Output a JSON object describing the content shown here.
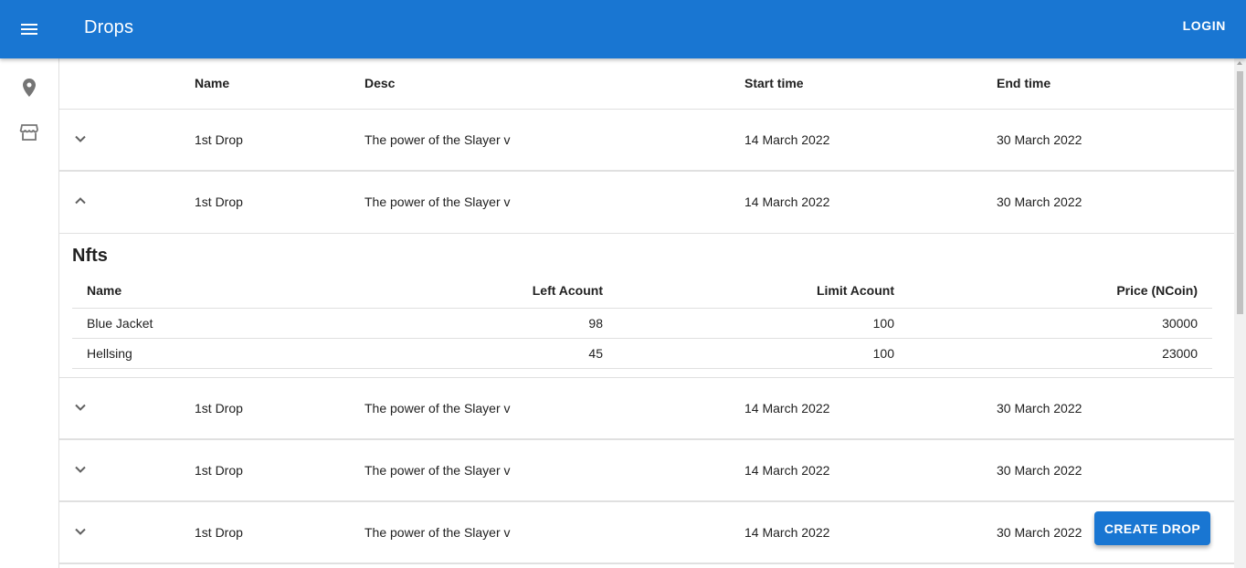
{
  "appbar": {
    "title": "Drops",
    "login_label": "LOGIN"
  },
  "sidebar": {
    "icons": [
      "location-pin-icon",
      "store-icon"
    ]
  },
  "table": {
    "headers": {
      "name": "Name",
      "desc": "Desc",
      "start": "Start time",
      "end": "End time"
    },
    "rows": [
      {
        "name": "1st Drop",
        "desc": "The power of the Slayer v",
        "start": "14 March 2022",
        "end": "30 March 2022",
        "expanded": false
      },
      {
        "name": "1st Drop",
        "desc": "The power of the Slayer v",
        "start": "14 March 2022",
        "end": "30 March 2022",
        "expanded": true
      },
      {
        "name": "1st Drop",
        "desc": "The power of the Slayer v",
        "start": "14 March 2022",
        "end": "30 March 2022",
        "expanded": false
      },
      {
        "name": "1st Drop",
        "desc": "The power of the Slayer v",
        "start": "14 March 2022",
        "end": "30 March 2022",
        "expanded": false
      },
      {
        "name": "1st Drop",
        "desc": "The power of the Slayer v",
        "start": "14 March 2022",
        "end": "30 March 2022",
        "expanded": false
      }
    ]
  },
  "nfts": {
    "title": "Nfts",
    "headers": {
      "name": "Name",
      "left": "Left Acount",
      "limit": "Limit Acount",
      "price": "Price (NCoin)"
    },
    "rows": [
      {
        "name": "Blue Jacket",
        "left": "98",
        "limit": "100",
        "price": "30000"
      },
      {
        "name": "Hellsing",
        "left": "45",
        "limit": "100",
        "price": "23000"
      }
    ]
  },
  "create_button": {
    "label": "CREATE DROP"
  },
  "colors": {
    "primary": "#1976d2",
    "divider": "#e0e0e0"
  }
}
